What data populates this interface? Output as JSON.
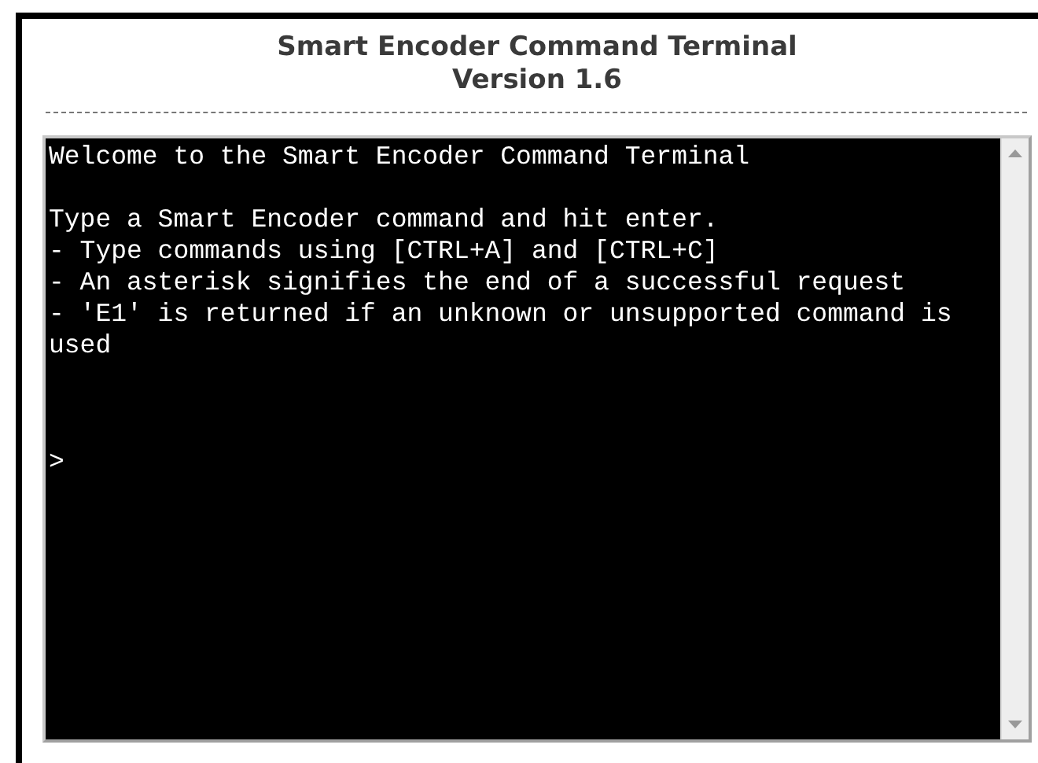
{
  "header": {
    "title": "Smart Encoder Command Terminal",
    "version": "Version 1.6"
  },
  "terminal": {
    "blocks": [
      {
        "lines": [
          "Welcome to the Smart Encoder Command Terminal"
        ]
      },
      {
        "lines": [
          "Type a Smart Encoder command and hit enter.",
          "- Type commands using [CTRL+A] and [CTRL+C]",
          "- An asterisk signifies the end of a successful request",
          "- 'E1' is returned if an unknown or unsupported command is used"
        ]
      }
    ],
    "prompt": ">"
  }
}
